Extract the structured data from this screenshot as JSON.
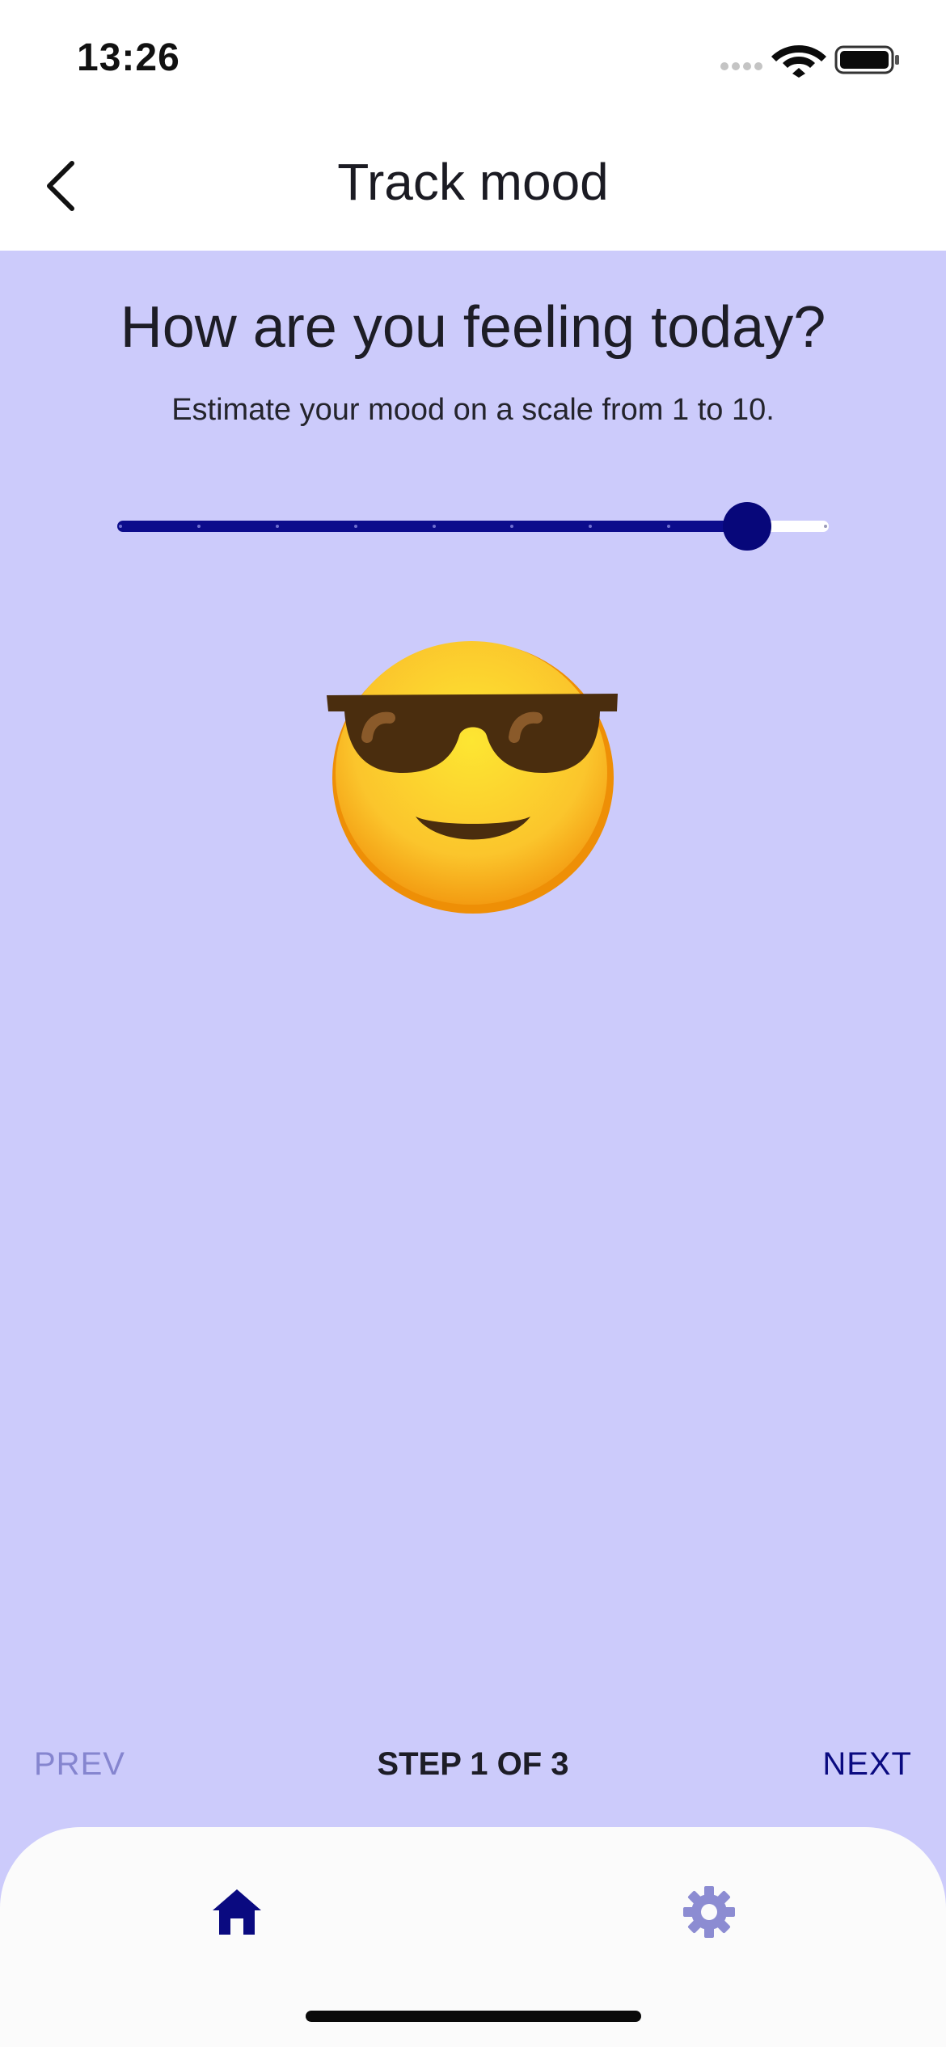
{
  "status_bar": {
    "time": "13:26"
  },
  "header": {
    "title": "Track mood"
  },
  "question": {
    "title": "How are you feeling today?",
    "subtitle": "Estimate your mood on a scale from 1 to 10."
  },
  "mood_slider": {
    "min": 1,
    "max": 10,
    "value": 9
  },
  "mood_emoji": "smiling-face-with-sunglasses",
  "step_nav": {
    "prev_label": "PREV",
    "step_label": "STEP 1 OF 3",
    "next_label": "NEXT"
  },
  "tabs": [
    {
      "icon": "home-icon",
      "active": true
    },
    {
      "icon": "gear-icon",
      "active": false
    }
  ],
  "colors": {
    "background": "#cccbfb",
    "accent": "#0a0a80",
    "inactive": "#8585cf"
  }
}
